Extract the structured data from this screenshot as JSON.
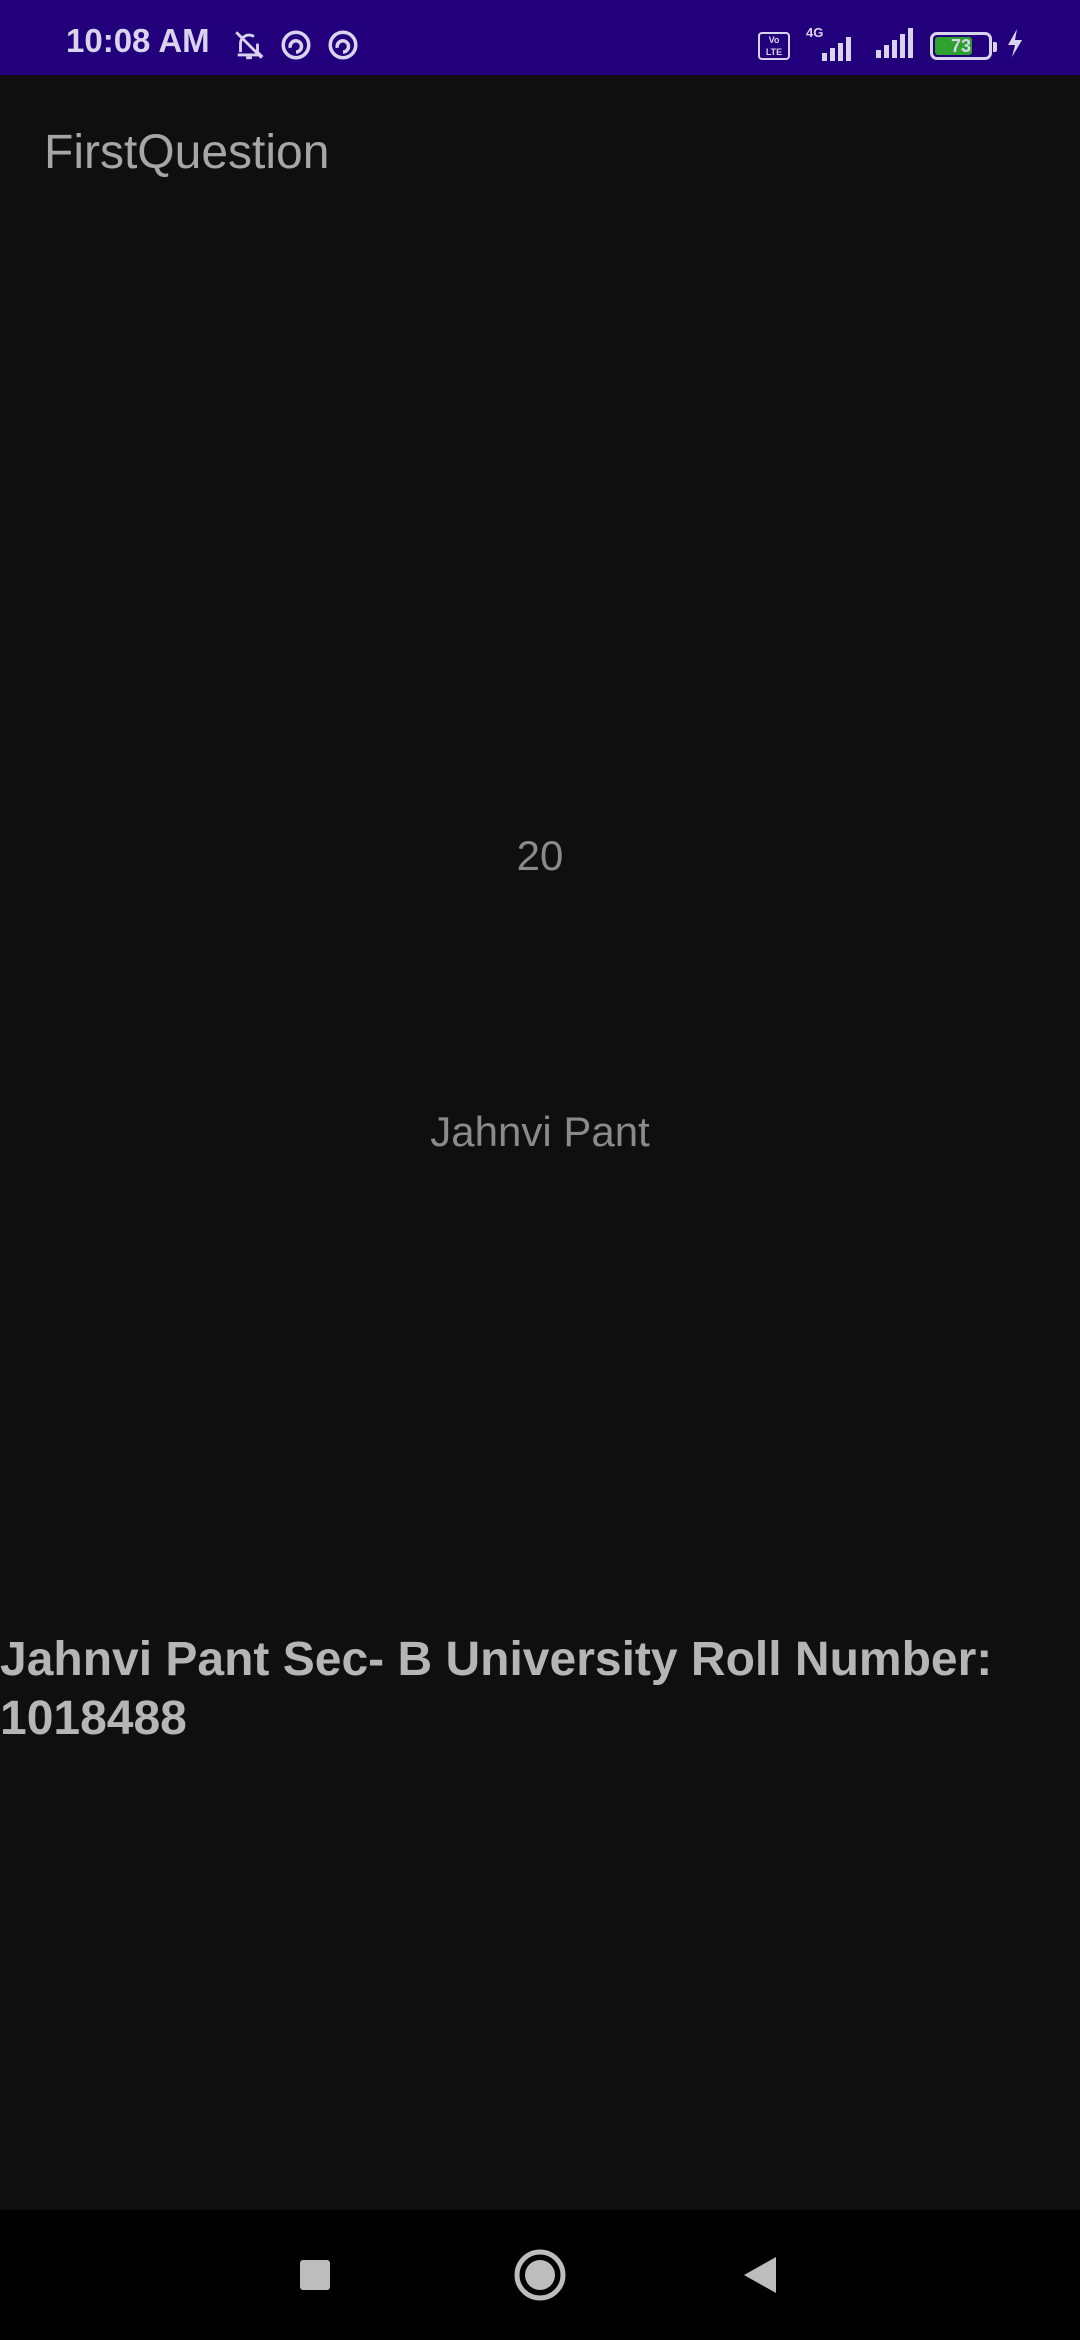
{
  "status_bar": {
    "time": "10:08 AM",
    "icons_left": [
      "bell-off-icon",
      "dnd-icon",
      "dnd-icon"
    ],
    "volte_label": "Vo LTE",
    "network_label": "4G",
    "battery_level": "73",
    "battery_fraction": 0.73,
    "charging": true,
    "background_color": "#22007c"
  },
  "app_bar": {
    "title": "FirstQuestion"
  },
  "main": {
    "count": "20",
    "name": "Jahnvi Pant",
    "info": "Jahnvi Pant Sec- B University Roll Number: 1018488"
  },
  "nav_bar": {
    "buttons": [
      "recent-apps-icon",
      "home-icon",
      "back-icon"
    ]
  }
}
